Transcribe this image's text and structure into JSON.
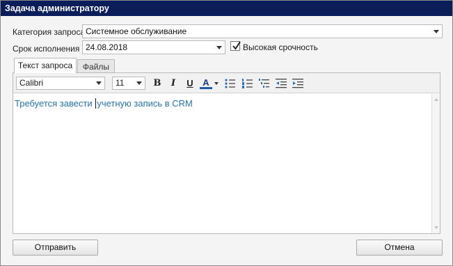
{
  "window": {
    "title": "Задача администратору"
  },
  "form": {
    "category_label": "Категория запроса",
    "category_value": "Системное обслуживание",
    "deadline_label": "Срок исполнения",
    "deadline_value": "24.08.2018",
    "urgent_label": "Высокая срочность",
    "urgent_checked": true
  },
  "tabs": [
    {
      "label": "Текст запроса",
      "active": true
    },
    {
      "label": "Файлы",
      "active": false
    }
  ],
  "toolbar": {
    "font_family": "Calibri",
    "font_size": "11",
    "bold": "B",
    "italic": "I",
    "underline": "U",
    "font_color": "A",
    "font_color_value": "#1f5aa8",
    "icons": [
      "bullet-list-icon",
      "numbered-list-icon",
      "multilevel-list-icon",
      "decrease-indent-icon",
      "increase-indent-icon"
    ]
  },
  "editor": {
    "text_before_caret": "Требуется завести ",
    "text_after_caret": "учетную запись в CRM",
    "text_color": "#2574a9"
  },
  "buttons": {
    "send": "Отправить",
    "cancel": "Отмена"
  },
  "colors": {
    "titlebar": "#0b1e5a"
  }
}
